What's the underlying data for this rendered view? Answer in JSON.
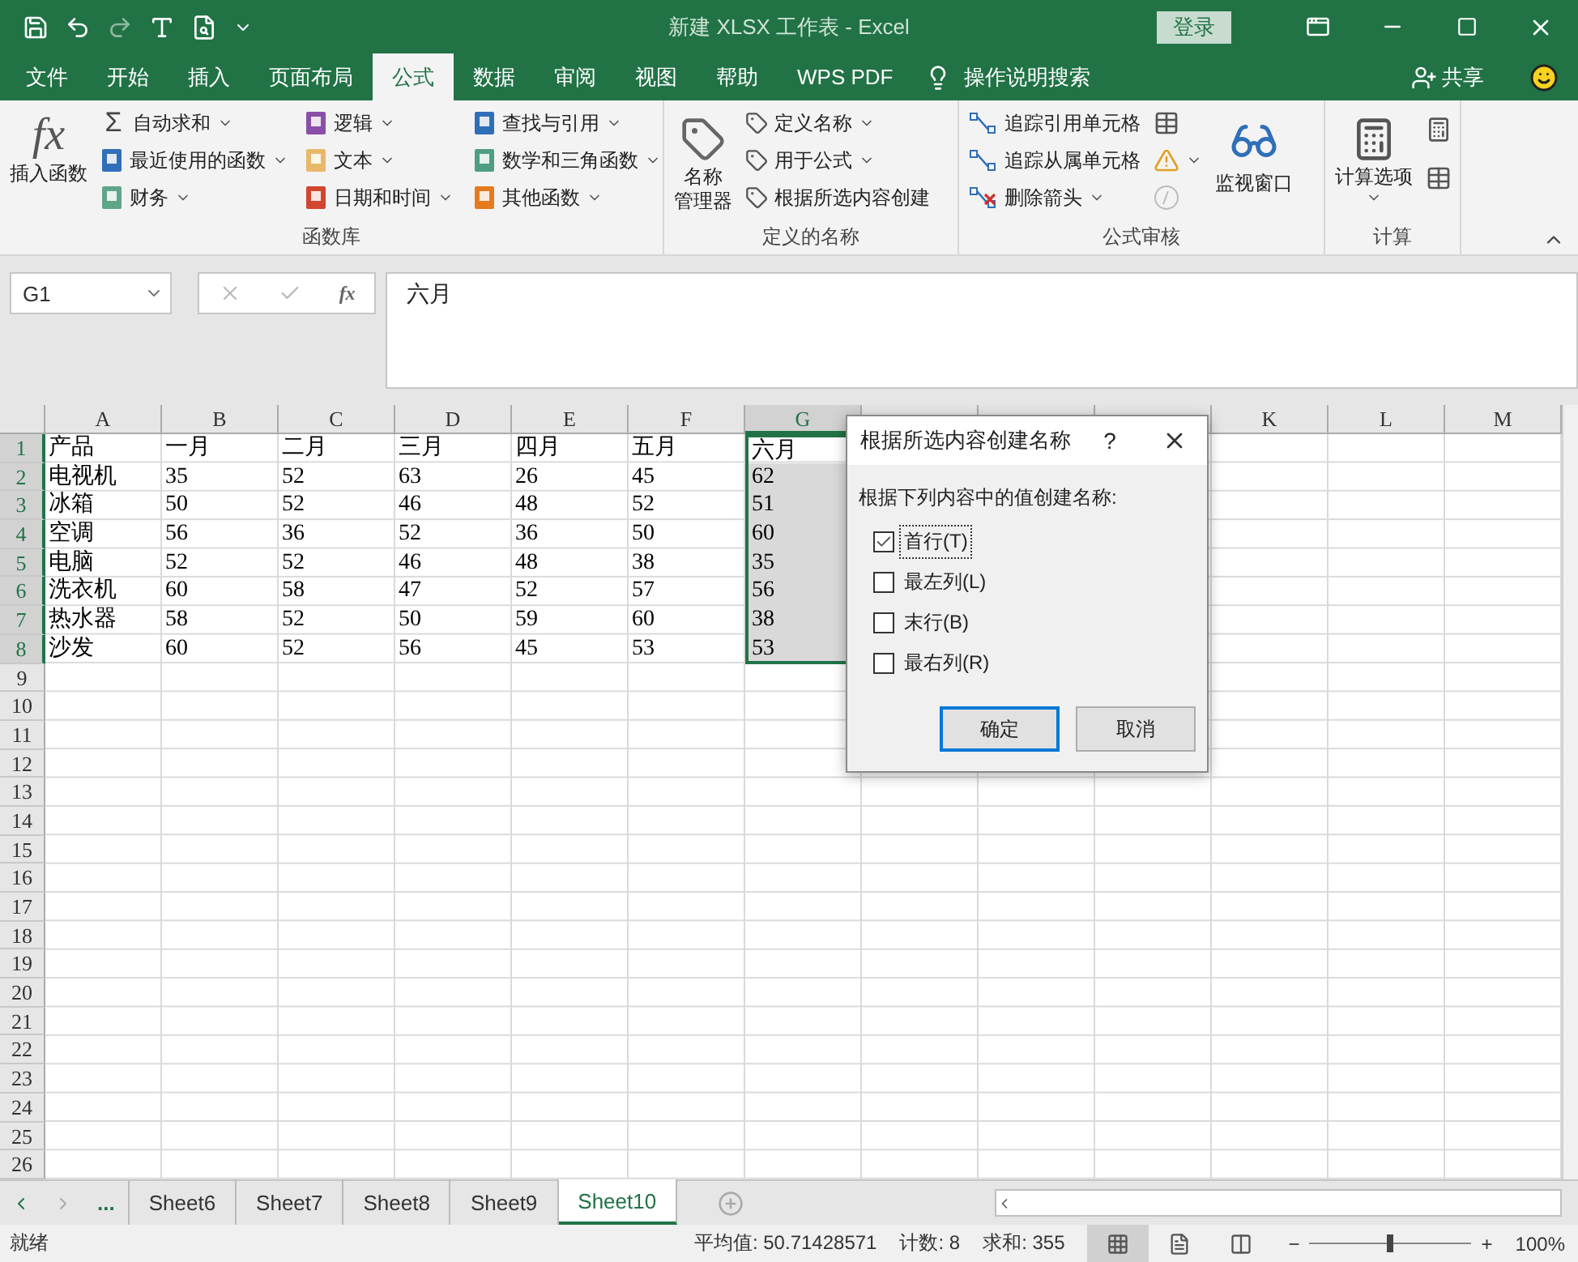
{
  "title_bar": {
    "title": "新建 XLSX 工作表  -  Excel",
    "login_button": "登录"
  },
  "ribbon_tabs": [
    {
      "label": "文件",
      "selected": false
    },
    {
      "label": "开始",
      "selected": false
    },
    {
      "label": "插入",
      "selected": false
    },
    {
      "label": "页面布局",
      "selected": false
    },
    {
      "label": "公式",
      "selected": true
    },
    {
      "label": "数据",
      "selected": false
    },
    {
      "label": "审阅",
      "selected": false
    },
    {
      "label": "视图",
      "selected": false
    },
    {
      "label": "帮助",
      "selected": false
    },
    {
      "label": "WPS PDF",
      "selected": false
    }
  ],
  "tell_me": "操作说明搜索",
  "share": "共享",
  "ribbon": {
    "function_library": {
      "insert_function": {
        "icon_text": "fx",
        "label": "插入函数"
      },
      "columns": [
        [
          {
            "label": "自动求和",
            "glyph": "Σ",
            "dropdown": true
          },
          {
            "label": "最近使用的函数",
            "color": "#2f6fb7",
            "dropdown": true
          },
          {
            "label": "财务",
            "color": "#5fa58a",
            "dropdown": true
          }
        ],
        [
          {
            "label": "逻辑",
            "color": "#8a4fa8",
            "dropdown": true
          },
          {
            "label": "文本",
            "color": "#e8b86a",
            "dropdown": true
          },
          {
            "label": "日期和时间",
            "color": "#d2452f",
            "dropdown": true
          }
        ],
        [
          {
            "label": "查找与引用",
            "color": "#2f6fb7",
            "dropdown": true
          },
          {
            "label": "数学和三角函数",
            "color": "#4f9e82",
            "dropdown": true
          },
          {
            "label": "其他函数",
            "color": "#e57b1e",
            "dropdown": true
          }
        ]
      ],
      "group_label": "函数库"
    },
    "defined_names": {
      "name_manager": [
        "名称",
        "管理器"
      ],
      "items": [
        {
          "label": "定义名称",
          "dropdown": true
        },
        {
          "label": "用于公式",
          "dropdown": true
        },
        {
          "label": "根据所选内容创建",
          "dropdown": false
        }
      ],
      "group_label": "定义的名称"
    },
    "formula_auditing": {
      "items": [
        {
          "label": "追踪引用单元格",
          "dropdown": false
        },
        {
          "label": "追踪从属单元格",
          "dropdown": false
        },
        {
          "label": "删除箭头",
          "dropdown": true
        }
      ],
      "tools": [
        {
          "kind": "show-formulas",
          "dropdown": false,
          "disabled": false
        },
        {
          "kind": "error-check",
          "dropdown": true,
          "disabled": false
        },
        {
          "kind": "evaluate",
          "dropdown": false,
          "disabled": true
        }
      ],
      "watch_window": "监视窗口",
      "group_label": "公式审核"
    },
    "calculation": {
      "calc_options": "计算选项",
      "group_label": "计算"
    }
  },
  "formula_bar": {
    "name_box": "G1",
    "insert_function": "fx",
    "formula": "六月"
  },
  "sheet": {
    "columns": [
      {
        "letter": "A",
        "selected": false
      },
      {
        "letter": "B",
        "selected": false
      },
      {
        "letter": "C",
        "selected": false
      },
      {
        "letter": "D",
        "selected": false
      },
      {
        "letter": "E",
        "selected": false
      },
      {
        "letter": "F",
        "selected": false
      },
      {
        "letter": "G",
        "selected": true
      }
    ],
    "columns_right": [
      {
        "letter": "K",
        "selected": false
      },
      {
        "letter": "L",
        "selected": false
      },
      {
        "letter": "M",
        "selected": false
      }
    ],
    "row_headers": [
      {
        "label": "1",
        "selected": true
      },
      {
        "label": "2",
        "selected": true
      },
      {
        "label": "3",
        "selected": true
      },
      {
        "label": "4",
        "selected": true
      },
      {
        "label": "5",
        "selected": true
      },
      {
        "label": "6",
        "selected": true
      },
      {
        "label": "7",
        "selected": true
      },
      {
        "label": "8",
        "selected": true
      },
      {
        "label": "9",
        "selected": false
      },
      {
        "label": "10",
        "selected": false
      },
      {
        "label": "11",
        "selected": false
      },
      {
        "label": "12",
        "selected": false
      },
      {
        "label": "13",
        "selected": false
      },
      {
        "label": "14",
        "selected": false
      },
      {
        "label": "15",
        "selected": false
      },
      {
        "label": "16",
        "selected": false
      },
      {
        "label": "17",
        "selected": false
      },
      {
        "label": "18",
        "selected": false
      },
      {
        "label": "19",
        "selected": false
      },
      {
        "label": "20",
        "selected": false
      },
      {
        "label": "21",
        "selected": false
      },
      {
        "label": "22",
        "selected": false
      },
      {
        "label": "23",
        "selected": false
      },
      {
        "label": "24",
        "selected": false
      },
      {
        "label": "25",
        "selected": false
      },
      {
        "label": "26",
        "selected": false
      }
    ],
    "rows": [
      [
        "产品",
        "一月",
        "二月",
        "三月",
        "四月",
        "五月",
        "六月"
      ],
      [
        "电视机",
        "35",
        "52",
        "63",
        "26",
        "45",
        "62"
      ],
      [
        "冰箱",
        "50",
        "52",
        "46",
        "48",
        "52",
        "51"
      ],
      [
        "空调",
        "56",
        "36",
        "52",
        "36",
        "50",
        "60"
      ],
      [
        "电脑",
        "52",
        "52",
        "46",
        "48",
        "38",
        "35"
      ],
      [
        "洗衣机",
        "60",
        "58",
        "47",
        "52",
        "57",
        "56"
      ],
      [
        "热水器",
        "58",
        "52",
        "50",
        "59",
        "60",
        "38"
      ],
      [
        "沙发",
        "60",
        "52",
        "56",
        "45",
        "53",
        "53"
      ]
    ]
  },
  "dialog": {
    "title": "根据所选内容创建名称",
    "help": "?",
    "prompt": "根据下列内容中的值创建名称:",
    "options": [
      {
        "label": "首行(T)",
        "checked": true,
        "focused": true
      },
      {
        "label": "最左列(L)",
        "checked": false,
        "focused": false
      },
      {
        "label": "末行(B)",
        "checked": false,
        "focused": false
      },
      {
        "label": "最右列(R)",
        "checked": false,
        "focused": false
      }
    ],
    "buttons": [
      {
        "label": "确定",
        "default": true
      },
      {
        "label": "取消",
        "default": false
      }
    ]
  },
  "sheet_tabs": {
    "more": "...",
    "tabs": [
      {
        "label": "Sheet6",
        "selected": false
      },
      {
        "label": "Sheet7",
        "selected": false
      },
      {
        "label": "Sheet8",
        "selected": false
      },
      {
        "label": "Sheet9",
        "selected": false
      },
      {
        "label": "Sheet10",
        "selected": true
      }
    ]
  },
  "status_bar": {
    "status": "就绪",
    "average": "平均值: 50.71428571",
    "count": "计数: 8",
    "sum": "求和: 355",
    "views": [
      {
        "kind": "normal",
        "selected": true
      },
      {
        "kind": "page-layout",
        "selected": false
      },
      {
        "kind": "page-break",
        "selected": false
      }
    ],
    "zoom_out": "−",
    "zoom_in": "+",
    "zoom": {
      "level": 0.5,
      "reading": "100%"
    }
  }
}
